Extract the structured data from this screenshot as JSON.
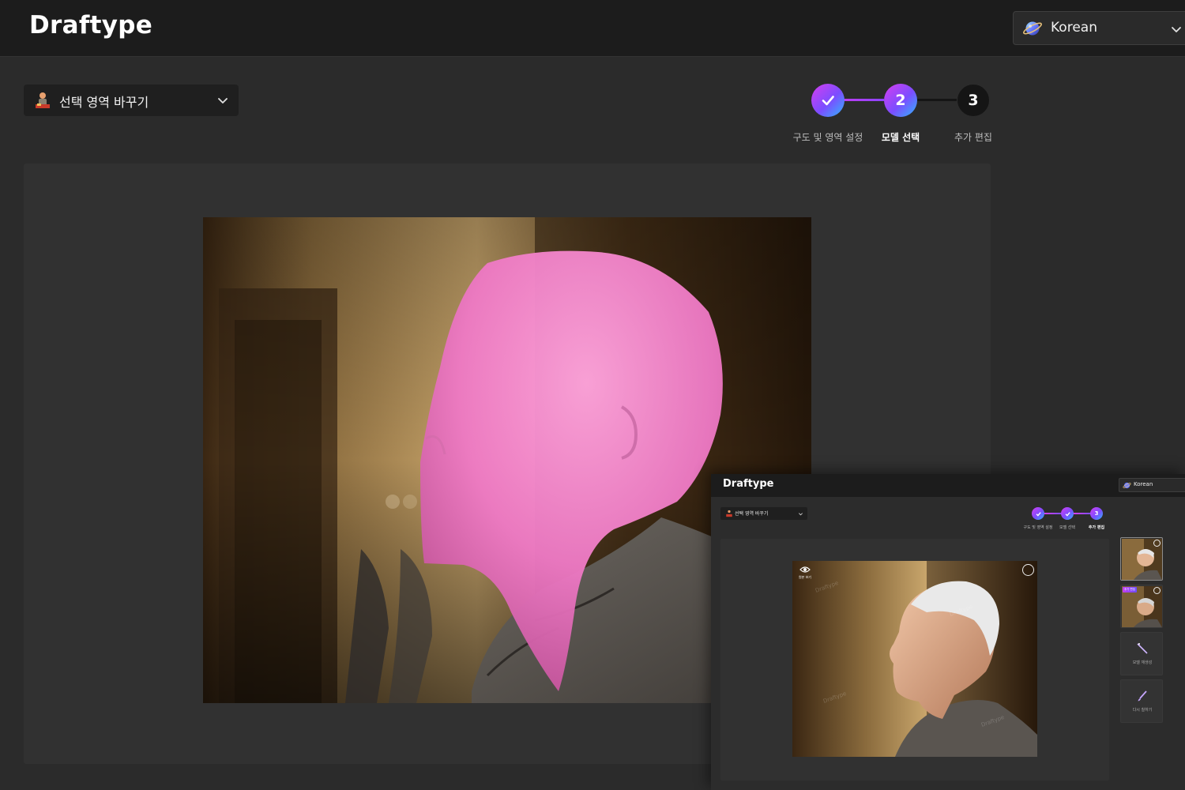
{
  "header": {
    "logo": "Draftype",
    "language": {
      "label": "Korean",
      "icon": "planet-globe-icon"
    }
  },
  "mode_select": {
    "label": "선택 영역 바꾸기",
    "icon": "mannequin-icon"
  },
  "stepper": {
    "steps": [
      {
        "label": "구도 및 영역 설정",
        "state": "done",
        "marker": ""
      },
      {
        "label": "모델 선택",
        "state": "current",
        "marker": "2"
      },
      {
        "label": "추가 편집",
        "state": "pending",
        "marker": "3"
      }
    ]
  },
  "editor": {
    "image": "profile photo with pink mask over head area",
    "mask_color": "#f27ac4"
  },
  "overlay_preview": {
    "logo": "Draftype",
    "language": "Korean",
    "mode_label": "선택 영역 바꾸기",
    "steps": [
      {
        "label": "구도 및 영역 설정",
        "state": "done",
        "marker": ""
      },
      {
        "label": "모델 선택",
        "state": "done",
        "marker": ""
      },
      {
        "label": "추가 편집",
        "state": "current",
        "marker": "3"
      }
    ],
    "eye_label": "원본 보기",
    "watermark": "Draftype",
    "thumb_tag": "추가 편집",
    "tools": [
      {
        "label": "모델 재생성",
        "icon": "wand-icon"
      },
      {
        "label": "다시 칠하기",
        "icon": "brush-icon"
      }
    ]
  },
  "colors": {
    "accent_gradient_start": "#d63ef0",
    "accent_gradient_end": "#2fb6ff",
    "background": "#2b2b2b",
    "header": "#1c1c1c"
  }
}
